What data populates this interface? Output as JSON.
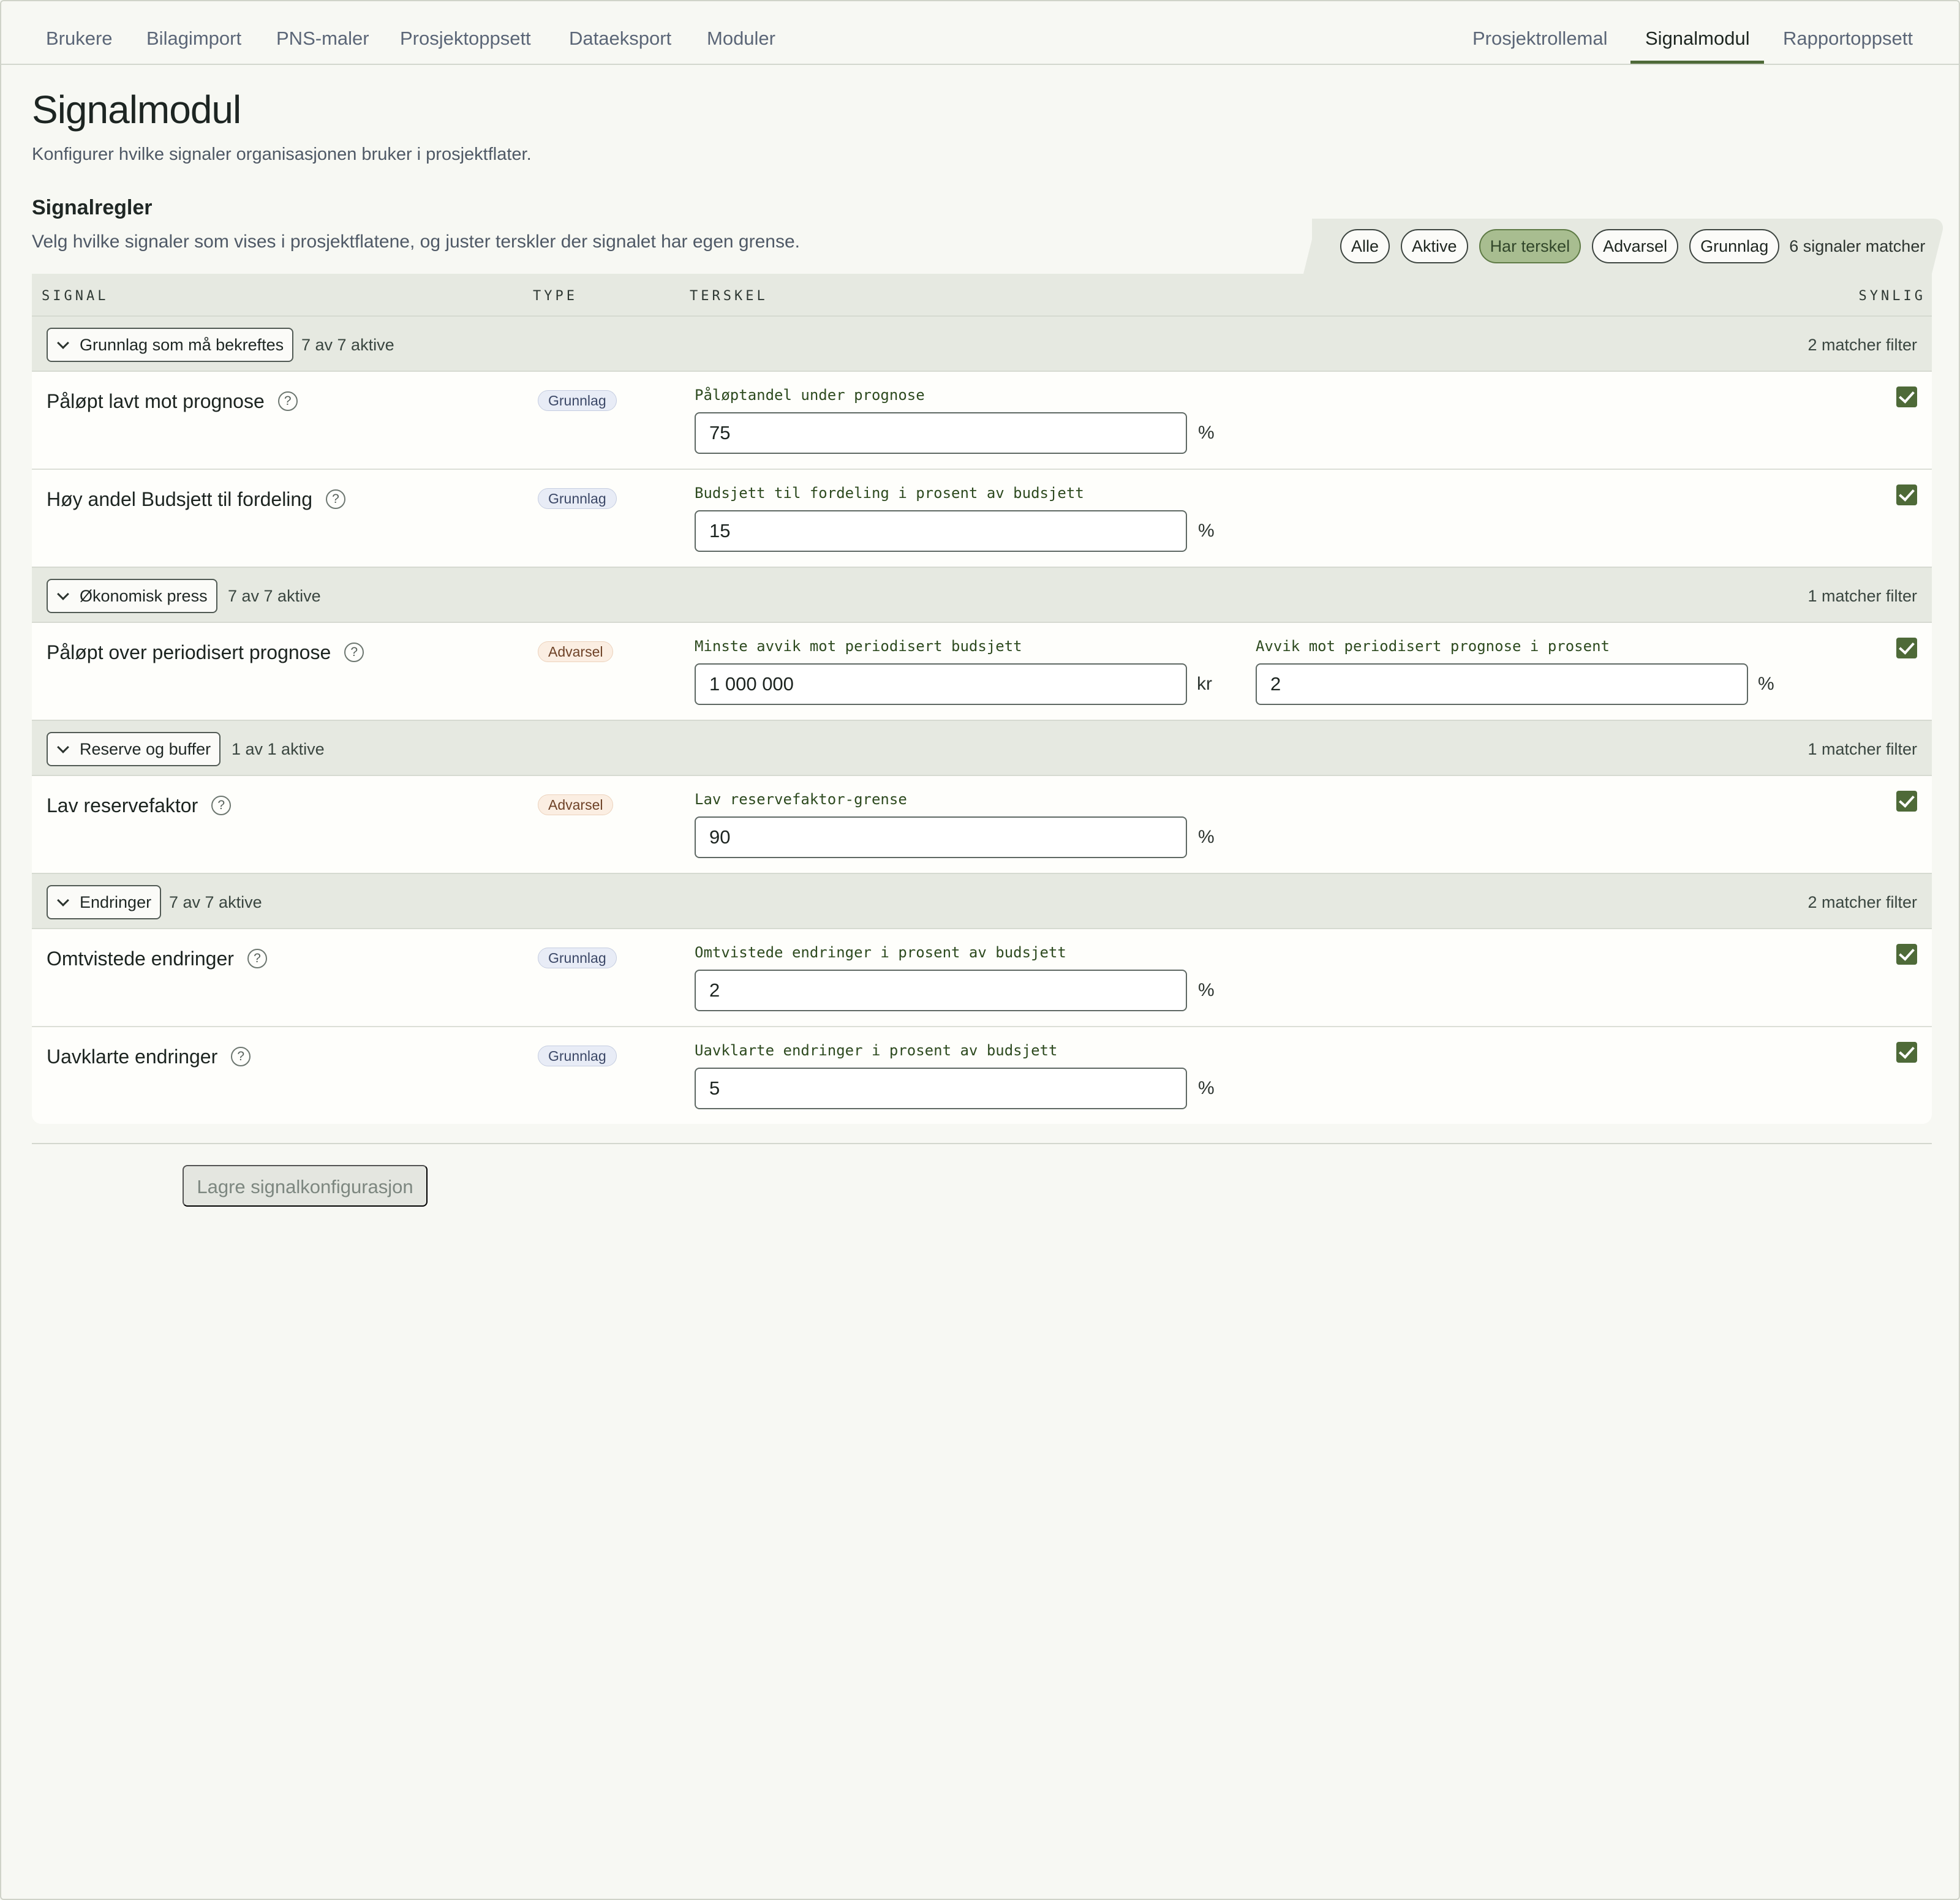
{
  "nav": {
    "left": [
      "Brukere",
      "Bilagimport",
      "PNS-maler",
      "Prosjektoppsett",
      "Dataeksport",
      "Moduler"
    ],
    "right": [
      "Prosjektrollemal",
      "Signalmodul",
      "Rapportoppsett"
    ],
    "active": "Signalmodul"
  },
  "page": {
    "title": "Signalmodul",
    "subtitle": "Konfigurer hvilke signaler organisasjonen bruker i prosjektflater."
  },
  "section": {
    "title": "Signalregler",
    "description": "Velg hvilke signaler som vises i prosjektflatene, og juster terskler der signalet har egen grense."
  },
  "filters": {
    "chips": [
      "Alle",
      "Aktive",
      "Har terskel",
      "Advarsel",
      "Grunnlag"
    ],
    "selected": "Har terskel",
    "match_count": "6 signaler matcher"
  },
  "table": {
    "headers": {
      "signal": "SIGNAL",
      "type": "TYPE",
      "threshold": "TERSKEL",
      "visible": "SYNLIG"
    },
    "groups": [
      {
        "label": "Grunnlag som må bekreftes",
        "count": "7 av 7 aktive",
        "match": "2 matcher filter"
      },
      {
        "label": "Økonomisk press",
        "count": "7 av 7 aktive",
        "match": "1 matcher filter"
      },
      {
        "label": "Reserve og buffer",
        "count": "1 av 1 aktive",
        "match": "1 matcher filter"
      },
      {
        "label": "Endringer",
        "count": "7 av 7 aktive",
        "match": "2 matcher filter"
      }
    ],
    "rows": [
      {
        "name": "Påløpt lavt mot prognose",
        "help": "?",
        "type": "Grunnlag",
        "f1_label": "Påløptandel under prognose",
        "f1_value": "75",
        "f1_unit": "%",
        "visible": true
      },
      {
        "name": "Høy andel Budsjett til fordeling",
        "help": "?",
        "type": "Grunnlag",
        "f1_label": "Budsjett til fordeling i prosent av budsjett",
        "f1_value": "15",
        "f1_unit": "%",
        "visible": true
      },
      {
        "name": "Påløpt over periodisert prognose",
        "help": "?",
        "type": "Advarsel",
        "f1_label": "Minste avvik mot periodisert budsjett",
        "f1_value": "1 000 000",
        "f1_unit": "kr",
        "f2_label": "Avvik mot periodisert prognose i prosent",
        "f2_value": "2",
        "f2_unit": "%",
        "visible": true
      },
      {
        "name": "Lav reservefaktor",
        "help": "?",
        "type": "Advarsel",
        "f1_label": "Lav reservefaktor-grense",
        "f1_value": "90",
        "f1_unit": "%",
        "visible": true
      },
      {
        "name": "Omtvistede endringer",
        "help": "?",
        "type": "Grunnlag",
        "f1_label": "Omtvistede endringer i prosent av budsjett",
        "f1_value": "2",
        "f1_unit": "%",
        "visible": true
      },
      {
        "name": "Uavklarte endringer",
        "help": "?",
        "type": "Grunnlag",
        "f1_label": "Uavklarte endringer i prosent av budsjett",
        "f1_value": "5",
        "f1_unit": "%",
        "visible": true
      }
    ]
  },
  "actions": {
    "save_label": "Lagre signalkonfigurasjon"
  },
  "colors": {
    "accent": "#4e6a38",
    "chip_selected": "#a8bd90",
    "header_bg": "#e6e9e1"
  }
}
